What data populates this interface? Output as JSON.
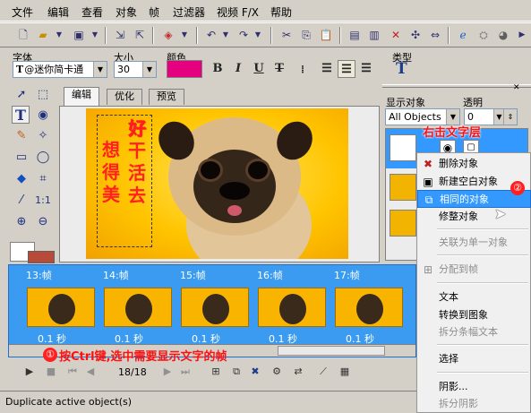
{
  "menu": [
    "文件",
    "编辑",
    "查看",
    "对象",
    "帧",
    "过滤器",
    "视频 F/X",
    "帮助"
  ],
  "toolbar_icons": [
    "new-icon",
    "open-icon",
    "save-icon",
    "import-icon",
    "export-icon",
    "color-palette-icon",
    "undo-icon",
    "redo-icon",
    "cut-icon",
    "copy-icon",
    "paste-icon",
    "frame-icon",
    "delete-icon",
    "crop-icon",
    "resize-icon",
    "browser-icon",
    "optimize-icon",
    "preview-icon"
  ],
  "props": {
    "font_label": "字体",
    "font_value": "@迷你简卡通",
    "size_label": "大小",
    "size_value": "30",
    "color_label": "颜色",
    "color_value": "#e4007f",
    "type_label": "类型",
    "format_buttons": [
      "B",
      "I",
      "U",
      "T"
    ]
  },
  "tabs": [
    "编辑",
    "优化",
    "预览"
  ],
  "canvas": {
    "text_col1": "好干活去",
    "text_col2": "好",
    "text_col3": "想得美"
  },
  "right_panel": {
    "display_label": "显示对象",
    "display_value": "All Objects",
    "opacity_label": "透明",
    "opacity_value": "0"
  },
  "context_menu": [
    {
      "label": "删除对象",
      "icon": "delete-x-icon",
      "enabled": true
    },
    {
      "label": "新建空白对象",
      "icon": "new-object-icon",
      "enabled": true
    },
    {
      "label": "相同的对象",
      "icon": "duplicate-icon",
      "enabled": true,
      "highlighted": true
    },
    {
      "label": "修整对象",
      "icon": "",
      "enabled": true
    },
    {
      "separator": true
    },
    {
      "label": "关联为单一对象",
      "icon": "",
      "enabled": false
    },
    {
      "separator": true
    },
    {
      "label": "分配到帧",
      "icon": "assign-frame-icon",
      "enabled": false
    },
    {
      "separator": true
    },
    {
      "label": "文本",
      "icon": "",
      "enabled": true
    },
    {
      "label": "转换到图象",
      "icon": "",
      "enabled": true
    },
    {
      "label": "拆分条幅文本",
      "icon": "",
      "enabled": false
    },
    {
      "separator": true
    },
    {
      "label": "选择",
      "icon": "",
      "enabled": true
    },
    {
      "separator": true
    },
    {
      "label": "阴影...",
      "icon": "",
      "enabled": true
    },
    {
      "label": "拆分阴影",
      "icon": "",
      "enabled": false
    }
  ],
  "timeline": {
    "frames": [
      {
        "label": "13:帧",
        "duration": "0.1 秒"
      },
      {
        "label": "14:帧",
        "duration": "0.1 秒"
      },
      {
        "label": "15:帧",
        "duration": "0.1 秒"
      },
      {
        "label": "16:帧",
        "duration": "0.1 秒"
      },
      {
        "label": "17:帧",
        "duration": "0.1 秒"
      }
    ],
    "counter": "18/18"
  },
  "annotations": {
    "step1_num": "①",
    "step1": "按Ctrl键,选中需要显示文字的帧",
    "step2_num": "②",
    "step_right": "右击文字层"
  },
  "status": "Duplicate active object(s)"
}
